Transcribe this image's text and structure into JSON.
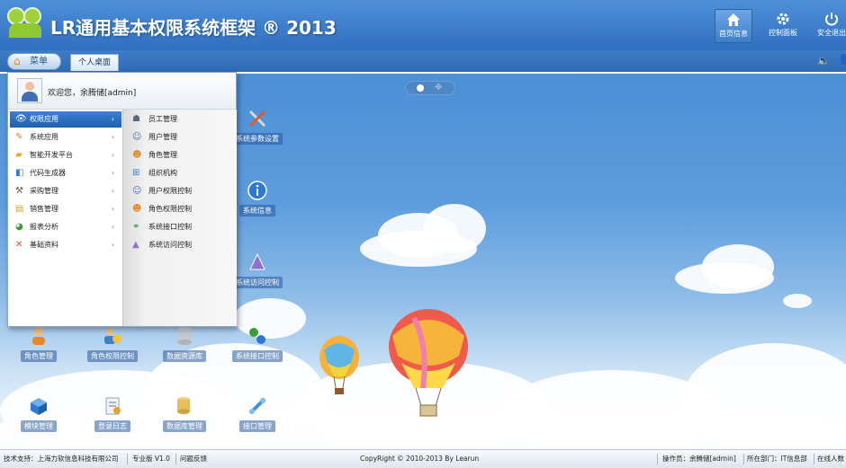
{
  "header": {
    "title": "LR通用基本权限系统框架 ® 2013",
    "buttons": [
      {
        "label": "首页信息",
        "icon": "home-icon"
      },
      {
        "label": "控制面板",
        "icon": "gear-icon"
      },
      {
        "label": "安全退出",
        "icon": "power-icon"
      }
    ]
  },
  "tabbar": {
    "menu_label": "菜单",
    "tabs": [
      "个人桌面"
    ]
  },
  "start_menu": {
    "welcome": "欢迎您，余腾储[admin]",
    "categories": [
      {
        "label": "权限应用",
        "icon": "eye-icon"
      },
      {
        "label": "系统应用",
        "icon": "pencil-icon"
      },
      {
        "label": "智能开发平台",
        "icon": "folder-icon"
      },
      {
        "label": "代码生成器",
        "icon": "code-icon"
      },
      {
        "label": "采购管理",
        "icon": "cart-icon"
      },
      {
        "label": "销售管理",
        "icon": "money-icon"
      },
      {
        "label": "报表分析",
        "icon": "chart-icon"
      },
      {
        "label": "基础资料",
        "icon": "tools-icon"
      }
    ],
    "sub_items": [
      {
        "label": "员工管理",
        "icon": "staff-icon"
      },
      {
        "label": "用户管理",
        "icon": "user-icon"
      },
      {
        "label": "角色管理",
        "icon": "role-icon"
      },
      {
        "label": "组织机构",
        "icon": "org-icon"
      },
      {
        "label": "用户权限控制",
        "icon": "user-permission-icon"
      },
      {
        "label": "角色权限控制",
        "icon": "role-permission-icon"
      },
      {
        "label": "系统接口控制",
        "icon": "interface-icon"
      },
      {
        "label": "系统访问控制",
        "icon": "access-icon"
      }
    ]
  },
  "desktop": {
    "icons": [
      {
        "label": "系统参数设置",
        "icon": "wrench-screwdriver-icon"
      },
      {
        "label": "系统信息",
        "icon": "info-icon"
      },
      {
        "label": "系统访问控制",
        "icon": "access-control-icon"
      },
      {
        "label": "角色管理",
        "icon": "role-icon"
      },
      {
        "label": "角色权限控制",
        "icon": "role-permission-icon"
      },
      {
        "label": "数据资源库",
        "icon": "database-icon"
      },
      {
        "label": "系统接口控制",
        "icon": "interface-icon"
      },
      {
        "label": "模块管理",
        "icon": "module-icon"
      },
      {
        "label": "登录日志",
        "icon": "log-icon"
      },
      {
        "label": "数据库管理",
        "icon": "db-manage-icon"
      },
      {
        "label": "接口管理",
        "icon": "api-icon"
      }
    ]
  },
  "footer": {
    "support": "技术支持：上海力软信息科技有限公司",
    "edition": "专业版 V1.0",
    "feedback": "问题反馈",
    "copyright": "CopyRight © 2010-2013 By Learun",
    "operator": "操作员：余腾储[admin]",
    "department": "所在部门：IT信息部",
    "online": "在线人数"
  },
  "colors": {
    "header": "#2f6fbf",
    "accent": "#1f5fb0",
    "sky_top": "#4b8fd6"
  }
}
